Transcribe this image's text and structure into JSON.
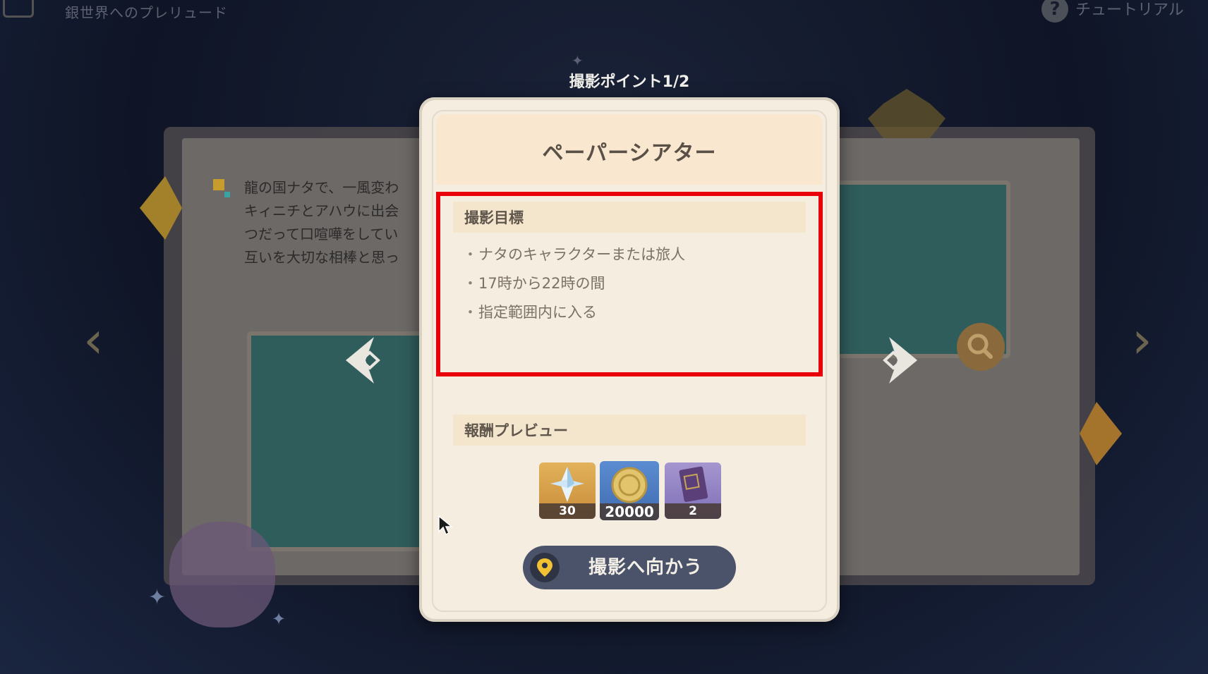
{
  "header": {
    "title": "銀世界へのプレリュード",
    "help_label": "チュートリアル"
  },
  "background_page": {
    "text_lines": [
      "龍の国ナタで、一風変わ",
      "キィニチとアハウに出会",
      "つだって口喧嘩をしてい",
      "互いを大切な相棒と思っ"
    ]
  },
  "point_label": "撮影ポイント1/2",
  "modal": {
    "title": "ペーパーシアター",
    "goal_section": {
      "label": "撮影目標",
      "items": [
        "ナタのキャラクターまたは旅人",
        "17時から22時の間",
        "指定範囲内に入る"
      ]
    },
    "reward_section": {
      "label": "報酬プレビュー",
      "rewards": [
        {
          "item": "primogem-icon",
          "count": "30"
        },
        {
          "item": "mora-icon",
          "count": "20000"
        },
        {
          "item": "heros-wit-book-icon",
          "count": "2"
        }
      ]
    },
    "go_button_label": "撮影へ向かう"
  },
  "colors": {
    "highlight": "#e8000a",
    "modal_bg": "#f4ede0",
    "button_bg": "#4a5369",
    "pin": "#f2c232"
  }
}
